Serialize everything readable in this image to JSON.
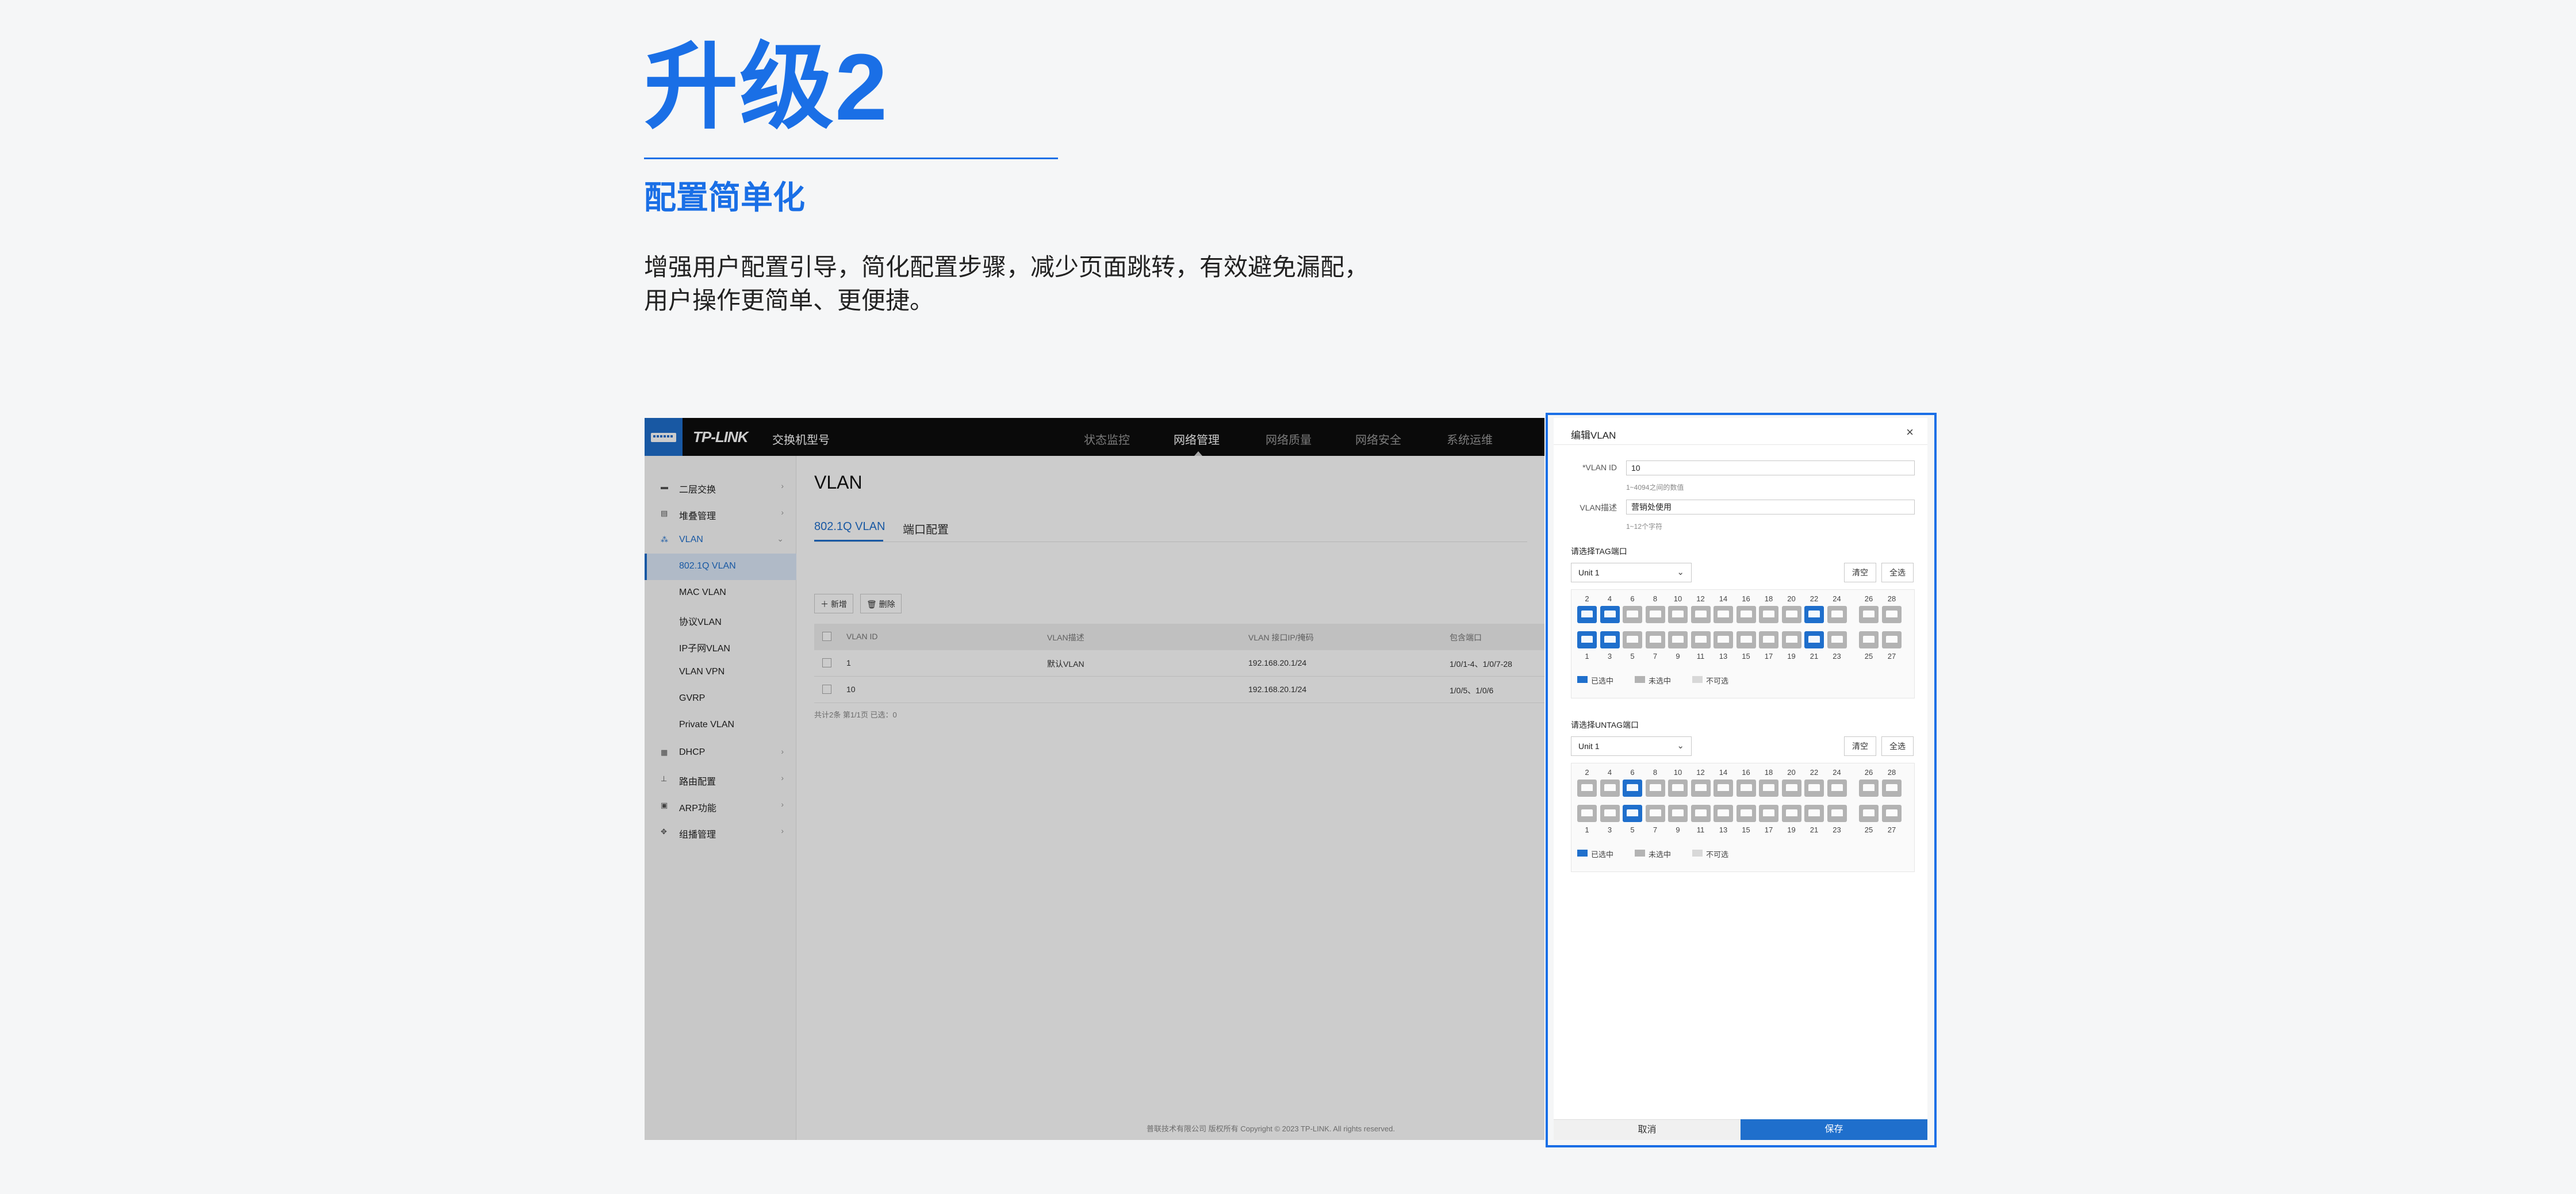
{
  "hero": {
    "title": "升级2",
    "subtitle": "配置简单化",
    "desc_line1": "增强用户配置引导，简化配置步骤，减少页面跳转，有效避免漏配，",
    "desc_line2": "用户操作更简单、更便捷。"
  },
  "topbar": {
    "brand": "TP-LINK",
    "model": "交换机型号",
    "nav": [
      "状态监控",
      "网络管理",
      "网络质量",
      "网络安全",
      "系统运维"
    ],
    "active_nav": "网络管理"
  },
  "sidebar": {
    "items": [
      {
        "label": "二层交换",
        "icon": "layers-icon"
      },
      {
        "label": "堆叠管理",
        "icon": "stack-icon"
      },
      {
        "label": "VLAN",
        "icon": "network-icon"
      },
      {
        "label": "DHCP",
        "icon": "server-icon"
      },
      {
        "label": "路由配置",
        "icon": "route-icon"
      },
      {
        "label": "ARP功能",
        "icon": "grid-icon"
      },
      {
        "label": "组播管理",
        "icon": "multicast-icon"
      }
    ],
    "vlan_sub": [
      "802.1Q VLAN",
      "MAC VLAN",
      "协议VLAN",
      "IP子网VLAN",
      "VLAN VPN",
      "GVRP",
      "Private VLAN"
    ]
  },
  "main": {
    "title": "VLAN",
    "tabs": [
      "802.1Q VLAN",
      "端口配置"
    ],
    "add_label": "新增",
    "delete_label": "删除",
    "headers": [
      "VLAN ID",
      "VLAN描述",
      "VLAN 接口IP/掩码",
      "包含端口"
    ],
    "rows": [
      {
        "id": "1",
        "desc": "默认VLAN",
        "ip": "192.168.20.1/24",
        "ports": "1/0/1-4、1/0/7-28"
      },
      {
        "id": "10",
        "desc": "",
        "ip": "192.168.20.1/24",
        "ports": "1/0/5、1/0/6"
      }
    ],
    "pager": "共计2条  第1/1页    已选：0",
    "footer": "普联技术有限公司 版权所有 Copyright © 2023 TP-LINK. All rights reserved."
  },
  "dialog": {
    "title": "编辑VLAN",
    "vlan_id_label": "*VLAN ID",
    "vlan_id_value": "10",
    "vlan_id_hint": "1~4094之间的数值",
    "desc_label": "VLAN描述",
    "desc_value": "营销处使用",
    "desc_hint": "1~12个字符",
    "tag_title": "请选择TAG端口",
    "untag_title": "请选择UNTAG端口",
    "unit": "Unit 1",
    "clear_label": "清空",
    "all_label": "全选",
    "top_nums": [
      "2",
      "4",
      "6",
      "8",
      "10",
      "12",
      "14",
      "16",
      "18",
      "20",
      "22",
      "24",
      "26",
      "28"
    ],
    "bottom_nums": [
      "1",
      "3",
      "5",
      "7",
      "9",
      "11",
      "13",
      "15",
      "17",
      "19",
      "21",
      "23",
      "25",
      "27"
    ],
    "legend": [
      "已选中",
      "未选中",
      "不可选"
    ],
    "cancel_label": "取消",
    "save_label": "保存",
    "tag_selected_top": [
      "2",
      "4",
      "22"
    ],
    "tag_selected_bottom": [
      "1",
      "3",
      "21"
    ],
    "untag_selected_top": [
      "6"
    ],
    "untag_selected_bottom": [
      "5"
    ],
    "colors": {
      "selected": "#1f6fcc",
      "unselected": "#b3b3b3",
      "disabled": "#d8d8d8"
    }
  }
}
